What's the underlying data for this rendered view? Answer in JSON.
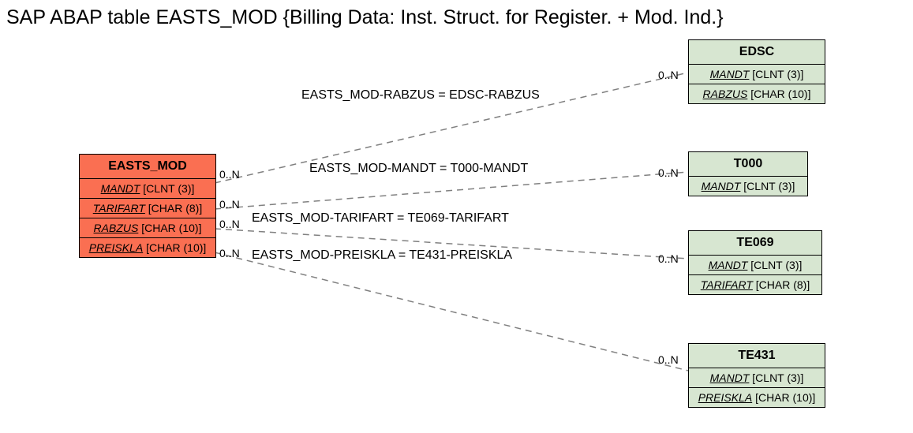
{
  "title": "SAP ABAP table EASTS_MOD {Billing Data: Inst. Struct. for Register. + Mod. Ind.}",
  "entities": {
    "easts_mod": {
      "name": "EASTS_MOD",
      "fields": [
        {
          "key": "MANDT",
          "type": "[CLNT (3)]"
        },
        {
          "key": "TARIFART",
          "type": "[CHAR (8)]"
        },
        {
          "key": "RABZUS",
          "type": "[CHAR (10)]"
        },
        {
          "key": "PREISKLA",
          "type": "[CHAR (10)]"
        }
      ]
    },
    "edsc": {
      "name": "EDSC",
      "fields": [
        {
          "key": "MANDT",
          "type": "[CLNT (3)]"
        },
        {
          "key": "RABZUS",
          "type": "[CHAR (10)]"
        }
      ]
    },
    "t000": {
      "name": "T000",
      "fields": [
        {
          "key": "MANDT",
          "type": "[CLNT (3)]"
        }
      ]
    },
    "te069": {
      "name": "TE069",
      "fields": [
        {
          "key": "MANDT",
          "type": "[CLNT (3)]"
        },
        {
          "key": "TARIFART",
          "type": "[CHAR (8)]"
        }
      ]
    },
    "te431": {
      "name": "TE431",
      "fields": [
        {
          "key": "MANDT",
          "type": "[CLNT (3)]"
        },
        {
          "key": "PREISKLA",
          "type": "[CHAR (10)]"
        }
      ]
    }
  },
  "relations": {
    "r1": {
      "label": "EASTS_MOD-RABZUS = EDSC-RABZUS",
      "leftCard": "0..N",
      "rightCard": "0..N"
    },
    "r2": {
      "label": "EASTS_MOD-MANDT = T000-MANDT",
      "leftCard": "0..N",
      "rightCard": "0..N"
    },
    "r3": {
      "label": "EASTS_MOD-TARIFART = TE069-TARIFART",
      "leftCard": "0..N",
      "rightCard": "0..N"
    },
    "r4": {
      "label": "EASTS_MOD-PREISKLA = TE431-PREISKLA",
      "leftCard": "0..N",
      "rightCard": "0..N"
    }
  }
}
